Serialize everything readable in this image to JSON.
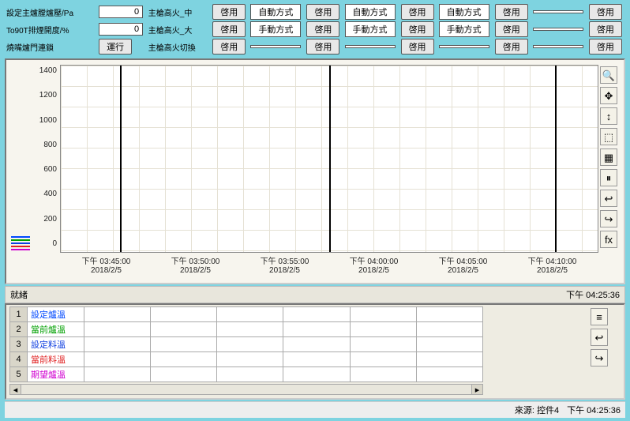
{
  "top": {
    "rows": [
      {
        "label": "設定主爐膛爐壓/Pa",
        "value": "0",
        "col2": "主槍高火_中",
        "b2": "啓用",
        "col3": "自動方式",
        "b3": "啓用",
        "col4": "自動方式",
        "b4": "啓用",
        "col5": "自動方式",
        "b5": "啓用",
        "col6": "",
        "b6": "啓用"
      },
      {
        "label": "To90T排煙開度/%",
        "value": "0",
        "col2": "主槍高火_大",
        "b2": "啓用",
        "col3": "手動方式",
        "b3": "啓用",
        "col4": "手動方式",
        "b4": "啓用",
        "col5": "手動方式",
        "b5": "啓用",
        "col6": "",
        "b6": "啓用"
      },
      {
        "label": "燒嘴爐門連鎖",
        "value": "運行",
        "col2": "主槍高火切換",
        "b2": "啓用",
        "col3": "",
        "b3": "啓用",
        "col4": "",
        "b4": "啓用",
        "col5": "",
        "b5": "啓用",
        "col6": "",
        "b6": "啓用"
      }
    ]
  },
  "chart_data": {
    "type": "line",
    "title": "",
    "ylabel": "",
    "xlabel": "",
    "ylim": [
      0,
      1500
    ],
    "yticks": [
      0,
      200,
      400,
      600,
      800,
      1000,
      1200,
      1400
    ],
    "xticks": [
      {
        "t": "下午 03:45:00",
        "d": "2018/2/5"
      },
      {
        "t": "下午 03:50:00",
        "d": "2018/2/5"
      },
      {
        "t": "下午 03:55:00",
        "d": "2018/2/5"
      },
      {
        "t": "下午 04:00:00",
        "d": "2018/2/5"
      },
      {
        "t": "下午 04:05:00",
        "d": "2018/2/5"
      },
      {
        "t": "下午 04:10:00",
        "d": "2018/2/5"
      }
    ],
    "series": [
      {
        "name": "設定爐溫",
        "color": "#0048ff",
        "values": []
      },
      {
        "name": "當前爐溫",
        "color": "#00a000",
        "values": []
      },
      {
        "name": "設定料溫",
        "color": "#1040e0",
        "values": []
      },
      {
        "name": "當前料溫",
        "color": "#e02020",
        "values": []
      },
      {
        "name": "期望爐溫",
        "color": "#d000d0",
        "values": []
      }
    ],
    "cursor_positions": [
      0.11,
      0.5,
      0.92
    ]
  },
  "status": {
    "left": "就緒",
    "right": "下午 04:25:36"
  },
  "legend_rows": [
    {
      "n": "1",
      "name": "設定爐溫",
      "color": "#0048ff"
    },
    {
      "n": "2",
      "name": "當前爐溫",
      "color": "#00a000"
    },
    {
      "n": "3",
      "name": "設定料溫",
      "color": "#1040e0"
    },
    {
      "n": "4",
      "name": "當前料溫",
      "color": "#e02020"
    },
    {
      "n": "5",
      "name": "期望爐溫",
      "color": "#d000d0"
    }
  ],
  "footer": {
    "source": "來源: 控件4",
    "time": "下午 04:25:36"
  },
  "tool_icons": [
    "🔍",
    "✥",
    "↕",
    "⬚",
    "▦",
    "⏸",
    "↩",
    "↪",
    "fx"
  ],
  "legend_tool_icons": [
    "≡",
    "↩",
    "↪"
  ]
}
